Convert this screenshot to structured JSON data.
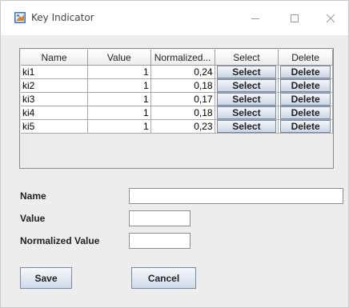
{
  "window": {
    "title": "Key Indicator",
    "icon": "app-icon",
    "controls": [
      "minimize-icon",
      "maximize-icon",
      "close-icon"
    ]
  },
  "table": {
    "columns": [
      "Name",
      "Value",
      "Normalized...",
      "Select",
      "Delete"
    ],
    "rows": [
      {
        "name": "ki1",
        "value": "1",
        "normalized": "0,24",
        "select": "Select",
        "delete": "Delete"
      },
      {
        "name": "ki2",
        "value": "1",
        "normalized": "0,18",
        "select": "Select",
        "delete": "Delete"
      },
      {
        "name": "ki3",
        "value": "1",
        "normalized": "0,17",
        "select": "Select",
        "delete": "Delete"
      },
      {
        "name": "ki4",
        "value": "1",
        "normalized": "0,18",
        "select": "Select",
        "delete": "Delete"
      },
      {
        "name": "ki5",
        "value": "1",
        "normalized": "0,23",
        "select": "Select",
        "delete": "Delete"
      }
    ]
  },
  "form": {
    "name_label": "Name",
    "name_value": "",
    "value_label": "Value",
    "value_value": "",
    "normalized_label": "Normalized Value",
    "normalized_value": ""
  },
  "buttons": {
    "save": "Save",
    "cancel": "Cancel"
  },
  "colors": {
    "button_border": "#7a8aa3",
    "button_bottom": "#c9d6e6",
    "panel_bg": "#ededed"
  }
}
